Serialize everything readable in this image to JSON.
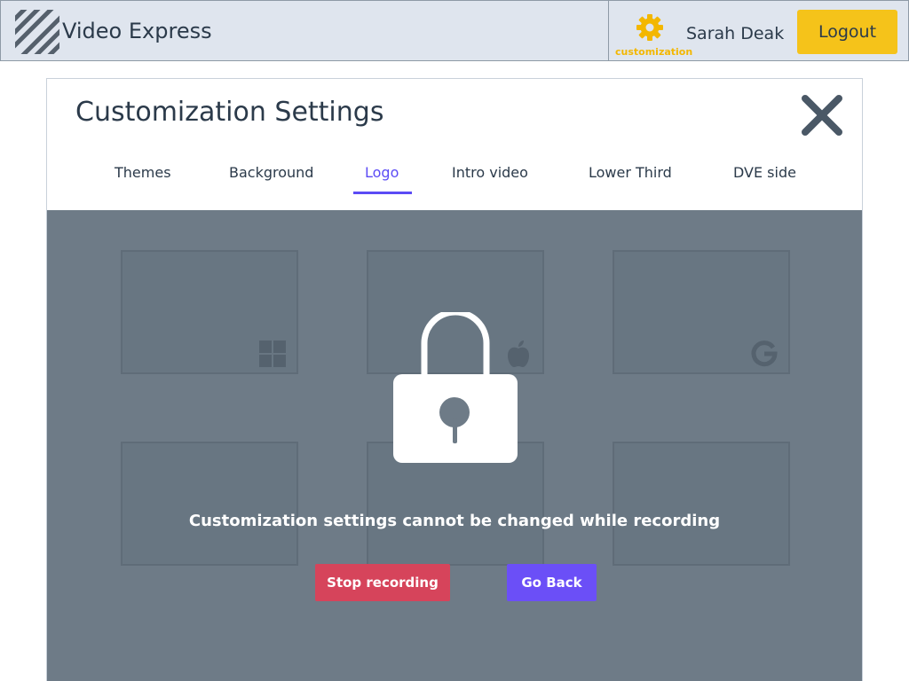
{
  "header": {
    "app_name": "Video Express",
    "customization_label": "customization",
    "user_name": "Sarah Deak",
    "logout_label": "Logout"
  },
  "modal": {
    "title": "Customization Settings",
    "tabs": [
      {
        "label": "Themes"
      },
      {
        "label": "Background"
      },
      {
        "label": "Logo",
        "active": true
      },
      {
        "label": "Intro video"
      },
      {
        "label": "Lower Third"
      },
      {
        "label": "DVE side"
      }
    ]
  },
  "logo_tiles": [
    {
      "icon": "windows-icon"
    },
    {
      "icon": "apple-icon"
    },
    {
      "icon": "google-icon"
    },
    {
      "icon": "none"
    },
    {
      "icon": "none"
    },
    {
      "icon": "none"
    }
  ],
  "lock_overlay": {
    "icon": "lock-icon",
    "message": "Customization settings cannot be changed while recording",
    "stop_label": "Stop recording",
    "back_label": "Go Back"
  },
  "colors": {
    "accent": "#5b4bf5",
    "logout": "#f5c31a",
    "customization": "#f3b700",
    "stop": "#d6445b",
    "go_back": "#6b4ff7",
    "overlay": "#6e7b87"
  }
}
